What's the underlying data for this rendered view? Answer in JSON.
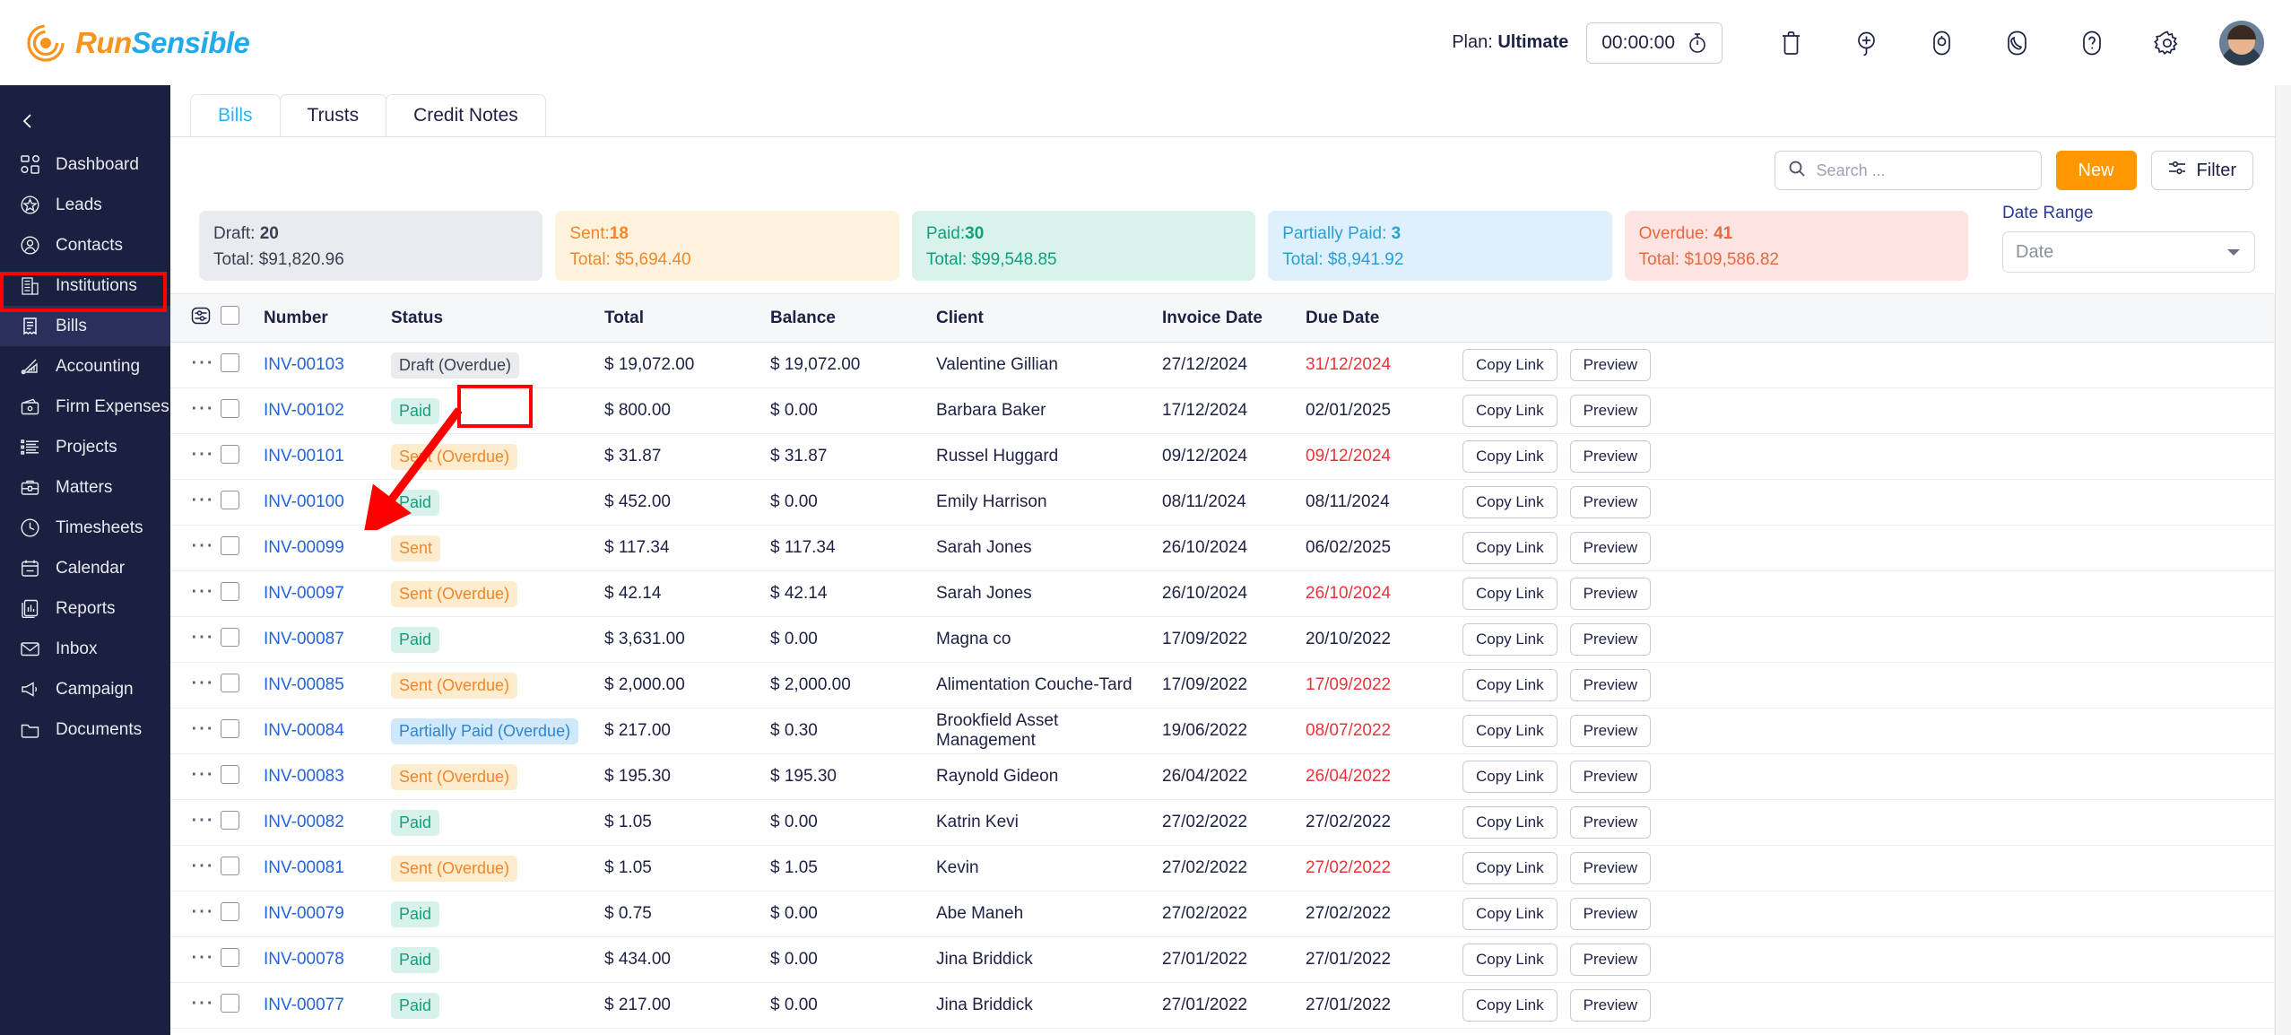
{
  "brand": {
    "name_part1": "Run",
    "name_part2": "Sensible"
  },
  "topbar": {
    "plan_label": "Plan:",
    "plan_value": "Ultimate",
    "timer": "00:00:00",
    "icons": [
      "stopwatch-icon",
      "trash-icon",
      "add-circle-icon",
      "bell-icon",
      "phone-icon",
      "help-icon",
      "gear-icon",
      "avatar"
    ]
  },
  "sidebar": {
    "collapse": "chevron-left-icon",
    "items": [
      {
        "label": "Dashboard",
        "icon": "dashboard-icon"
      },
      {
        "label": "Leads",
        "icon": "star-icon"
      },
      {
        "label": "Contacts",
        "icon": "user-icon"
      },
      {
        "label": "Institutions",
        "icon": "building-icon"
      },
      {
        "label": "Bills",
        "icon": "receipt-icon",
        "active": true
      },
      {
        "label": "Accounting",
        "icon": "chart-icon"
      },
      {
        "label": "Firm Expenses",
        "icon": "wallet-icon"
      },
      {
        "label": "Projects",
        "icon": "list-icon"
      },
      {
        "label": "Matters",
        "icon": "briefcase-icon"
      },
      {
        "label": "Timesheets",
        "icon": "clock-icon"
      },
      {
        "label": "Calendar",
        "icon": "calendar-icon"
      },
      {
        "label": "Reports",
        "icon": "report-icon"
      },
      {
        "label": "Inbox",
        "icon": "envelope-icon"
      },
      {
        "label": "Campaign",
        "icon": "megaphone-icon"
      },
      {
        "label": "Documents",
        "icon": "folder-icon"
      }
    ]
  },
  "tabs": [
    {
      "label": "Bills",
      "active": true
    },
    {
      "label": "Trusts",
      "active": false
    },
    {
      "label": "Credit Notes",
      "active": false
    }
  ],
  "toolbar": {
    "search_placeholder": "Search ...",
    "search_value": "",
    "new_label": "New",
    "filter_label": "Filter"
  },
  "date_range": {
    "label": "Date Range",
    "value": "Date"
  },
  "summary_cards": [
    {
      "title": "Draft:",
      "count": "20",
      "total": "Total: $91,820.96",
      "bg": "#e9ebef",
      "fg": "#3a3f52"
    },
    {
      "title": "Sent:",
      "count": "18",
      "total": "Total: $5,694.40",
      "bg": "#fdf3dd",
      "fg": "#f1862a"
    },
    {
      "title": "Paid:",
      "count": "30",
      "total": "Total: $99,548.85",
      "bg": "#d9f2ec",
      "fg": "#12a07c"
    },
    {
      "title": "Partially Paid:",
      "count": "3",
      "total": "Total: $8,941.92",
      "bg": "#ddf0fb",
      "fg": "#2b9ed4"
    },
    {
      "title": "Overdue:",
      "count": "41",
      "total": "Total: $109,586.82",
      "bg": "#fbe4e1",
      "fg": "#e8693e"
    }
  ],
  "table": {
    "settings_icon": "column-settings-icon",
    "headers": [
      "Number",
      "Status",
      "Total",
      "Balance",
      "Client",
      "Invoice Date",
      "Due Date"
    ],
    "row_actions": {
      "copy_link": "Copy Link",
      "preview": "Preview"
    },
    "status_styles": {
      "Draft (Overdue)": {
        "bg": "#e9ebef",
        "fg": "#3a3f52"
      },
      "Paid": {
        "bg": "#d6f2ea",
        "fg": "#13a07c"
      },
      "Sent": {
        "bg": "#fdeccd",
        "fg": "#f1862a"
      },
      "Sent (Overdue)": {
        "bg": "#fdeccd",
        "fg": "#f1862a"
      },
      "Partially Paid (Overdue)": {
        "bg": "#cfe8fb",
        "fg": "#2b85d4"
      }
    },
    "rows": [
      {
        "number": "INV-00103",
        "status": "Draft (Overdue)",
        "total": "$ 19,072.00",
        "balance": "$ 19,072.00",
        "client": "Valentine Gillian",
        "invoice_date": "27/12/2024",
        "due_date": "31/12/2024",
        "overdue": true
      },
      {
        "number": "INV-00102",
        "status": "Paid",
        "total": "$ 800.00",
        "balance": "$ 0.00",
        "client": "Barbara Baker",
        "invoice_date": "17/12/2024",
        "due_date": "02/01/2025",
        "overdue": false
      },
      {
        "number": "INV-00101",
        "status": "Sent (Overdue)",
        "total": "$ 31.87",
        "balance": "$ 31.87",
        "client": "Russel Huggard",
        "invoice_date": "09/12/2024",
        "due_date": "09/12/2024",
        "overdue": true
      },
      {
        "number": "INV-00100",
        "status": "Paid",
        "total": "$ 452.00",
        "balance": "$ 0.00",
        "client": "Emily Harrison",
        "invoice_date": "08/11/2024",
        "due_date": "08/11/2024",
        "overdue": false
      },
      {
        "number": "INV-00099",
        "status": "Sent",
        "total": "$ 117.34",
        "balance": "$ 117.34",
        "client": "Sarah Jones",
        "invoice_date": "26/10/2024",
        "due_date": "06/02/2025",
        "overdue": false
      },
      {
        "number": "INV-00097",
        "status": "Sent (Overdue)",
        "total": "$ 42.14",
        "balance": "$ 42.14",
        "client": "Sarah Jones",
        "invoice_date": "26/10/2024",
        "due_date": "26/10/2024",
        "overdue": true
      },
      {
        "number": "INV-00087",
        "status": "Paid",
        "total": "$ 3,631.00",
        "balance": "$ 0.00",
        "client": "Magna co",
        "invoice_date": "17/09/2022",
        "due_date": "20/10/2022",
        "overdue": false
      },
      {
        "number": "INV-00085",
        "status": "Sent (Overdue)",
        "total": "$ 2,000.00",
        "balance": "$ 2,000.00",
        "client": "Alimentation Couche-Tard",
        "invoice_date": "17/09/2022",
        "due_date": "17/09/2022",
        "overdue": true
      },
      {
        "number": "INV-00084",
        "status": "Partially Paid (Overdue)",
        "total": "$ 217.00",
        "balance": "$ 0.30",
        "client": "Brookfield Asset Management",
        "invoice_date": "19/06/2022",
        "due_date": "08/07/2022",
        "overdue": true
      },
      {
        "number": "INV-00083",
        "status": "Sent (Overdue)",
        "total": "$ 195.30",
        "balance": "$ 195.30",
        "client": "Raynold Gideon",
        "invoice_date": "26/04/2022",
        "due_date": "26/04/2022",
        "overdue": true
      },
      {
        "number": "INV-00082",
        "status": "Paid",
        "total": "$ 1.05",
        "balance": "$ 0.00",
        "client": "Katrin Kevi",
        "invoice_date": "27/02/2022",
        "due_date": "27/02/2022",
        "overdue": false
      },
      {
        "number": "INV-00081",
        "status": "Sent (Overdue)",
        "total": "$ 1.05",
        "balance": "$ 1.05",
        "client": "Kevin",
        "invoice_date": "27/02/2022",
        "due_date": "27/02/2022",
        "overdue": true
      },
      {
        "number": "INV-00079",
        "status": "Paid",
        "total": "$ 0.75",
        "balance": "$ 0.00",
        "client": "Abe Maneh",
        "invoice_date": "27/02/2022",
        "due_date": "27/02/2022",
        "overdue": false
      },
      {
        "number": "INV-00078",
        "status": "Paid",
        "total": "$ 434.00",
        "balance": "$ 0.00",
        "client": "Jina Briddick",
        "invoice_date": "27/01/2022",
        "due_date": "27/01/2022",
        "overdue": false
      },
      {
        "number": "INV-00077",
        "status": "Paid",
        "total": "$ 217.00",
        "balance": "$ 0.00",
        "client": "Jina Briddick",
        "invoice_date": "27/01/2022",
        "due_date": "27/01/2022",
        "overdue": false
      }
    ]
  },
  "annotations": {
    "highlight_color": "#ff0000",
    "boxes": [
      "sidebar-item-bills",
      "table-header-number"
    ],
    "arrow": "points-from-number-header-to-row-checkbox"
  }
}
